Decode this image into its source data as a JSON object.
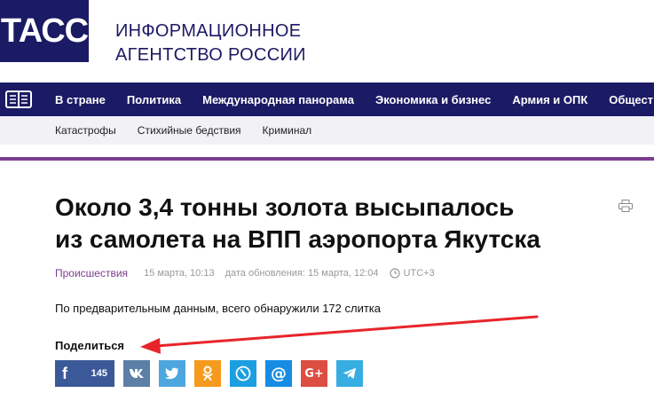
{
  "header": {
    "logo_text": "ТАСС",
    "agency_line1": "ИНФОРМАЦИОННОЕ",
    "agency_line2": "АГЕНТСТВО РОССИИ",
    "brand_color": "#1b1a64"
  },
  "nav": {
    "menu_icon": "menu-icon",
    "items": [
      {
        "label": "В стране"
      },
      {
        "label": "Политика"
      },
      {
        "label": "Международная панорама"
      },
      {
        "label": "Экономика и бизнес"
      },
      {
        "label": "Армия и ОПК"
      },
      {
        "label": "Общест"
      }
    ]
  },
  "subnav": {
    "items": [
      {
        "label": "Катастрофы"
      },
      {
        "label": "Стихийные бедствия"
      },
      {
        "label": "Криминал"
      }
    ],
    "accent_color": "#7b3d8e"
  },
  "article": {
    "title_line1": "Около 3,4 тонны золота высыпалось",
    "title_line2": "из самолета на ВПП аэропорта Якутска",
    "category": "Происшествия",
    "published": "15 марта, 10:13",
    "updated": "дата обновления: 15 марта, 12:04",
    "timezone": "UTC+3",
    "lead": "По предварительным данным, всего обнаружили 172 слитка"
  },
  "share": {
    "title": "Поделиться",
    "facebook_count": "145",
    "buttons": [
      {
        "network": "facebook",
        "label": "f",
        "color": "#3b5998"
      },
      {
        "network": "vk",
        "label": "vk",
        "color": "#5b7fa6"
      },
      {
        "network": "twitter",
        "label": "twitter",
        "color": "#4da7de"
      },
      {
        "network": "odnoklassniki",
        "label": "ok",
        "color": "#f59a1c"
      },
      {
        "network": "livejournal",
        "label": "lj",
        "color": "#1b9fe0"
      },
      {
        "network": "mail",
        "label": "@",
        "color": "#168de2"
      },
      {
        "network": "googleplus",
        "label": "G+",
        "color": "#dc4e41"
      },
      {
        "network": "telegram",
        "label": "telegram",
        "color": "#37aee2"
      }
    ]
  },
  "annotation_color": "#e8252b"
}
